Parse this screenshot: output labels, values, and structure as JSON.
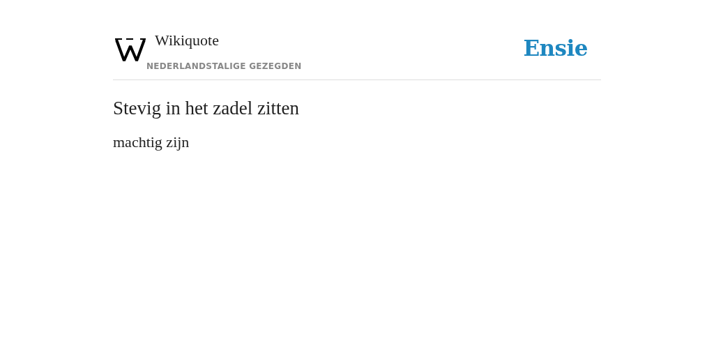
{
  "header": {
    "site_name": "Wikiquote",
    "subtitle": "NEDERLANDSTALIGE GEZEGDEN",
    "brand": "Ensie"
  },
  "entry": {
    "title": "Stevig in het zadel zitten",
    "definition": "machtig zijn"
  }
}
